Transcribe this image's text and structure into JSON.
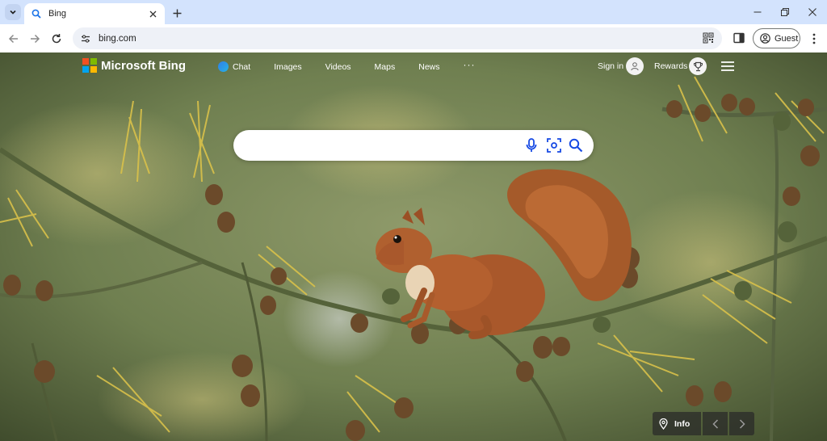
{
  "browser": {
    "tab": {
      "title": "Bing"
    },
    "url": "bing.com",
    "profile_label": "Guest"
  },
  "bing": {
    "logo_text": "Microsoft Bing",
    "nav": [
      {
        "label": "Chat"
      },
      {
        "label": "Images"
      },
      {
        "label": "Videos"
      },
      {
        "label": "Maps"
      },
      {
        "label": "News"
      }
    ],
    "more_label": "···",
    "signin_label": "Sign in",
    "rewards_label": "Rewards",
    "search": {
      "value": "",
      "placeholder": ""
    },
    "info_label": "Info"
  },
  "colors": {
    "tabstrip": "#d3e3fd",
    "logo_red": "#f25022",
    "logo_green": "#7fba00",
    "logo_blue": "#00a4ef",
    "logo_yellow": "#ffb900",
    "search_icon_blue": "#174ae4"
  }
}
